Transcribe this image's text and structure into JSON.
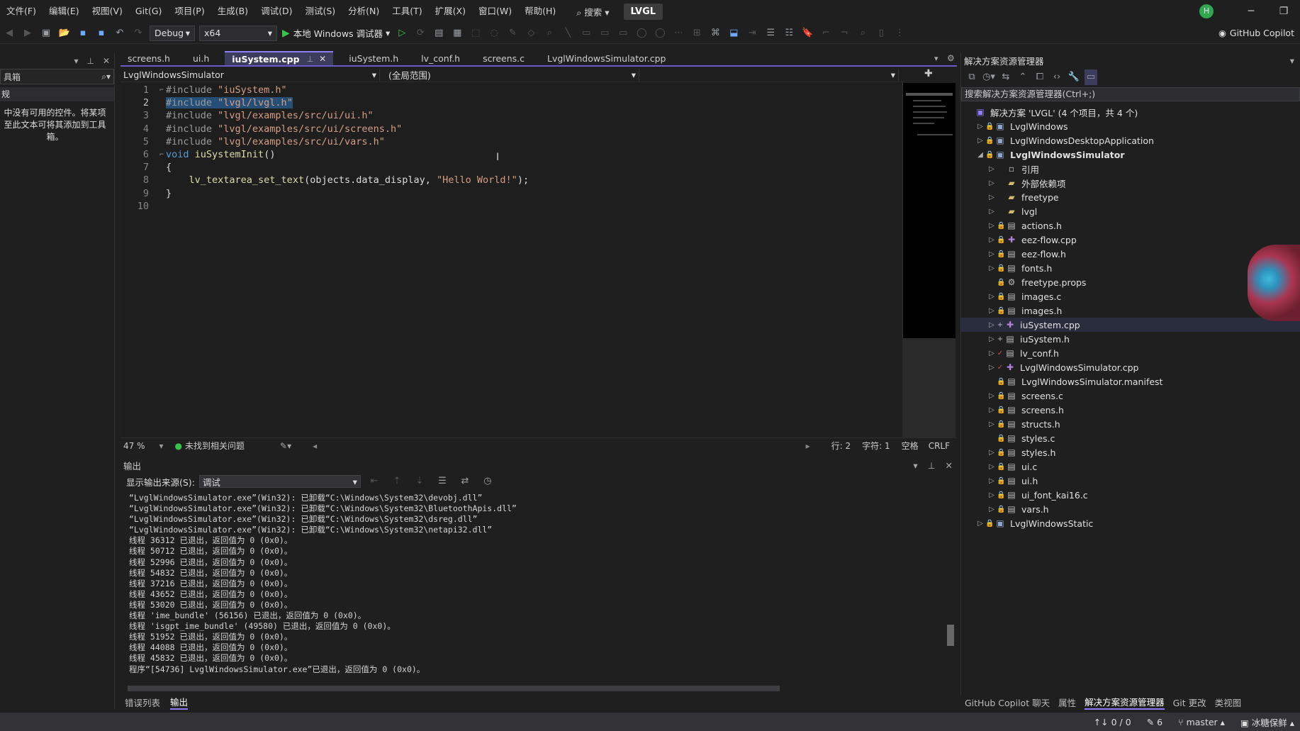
{
  "menu": [
    "文件(F)",
    "编辑(E)",
    "视图(V)",
    "Git(G)",
    "项目(P)",
    "生成(B)",
    "调试(D)",
    "测试(S)",
    "分析(N)",
    "工具(T)",
    "扩展(X)",
    "窗口(W)",
    "帮助(H)"
  ],
  "search_label": "搜索",
  "solution_badge": "LVGL",
  "avatar_initial": "H",
  "toolbar": {
    "config": "Debug",
    "platform": "x64",
    "run_label": "本地 Windows 调试器",
    "copilot_label": "GitHub Copilot"
  },
  "toolbox": {
    "title": "具箱",
    "section": "规",
    "message": "中没有可用的控件。将某项至此文本可将其添加到工具箱。"
  },
  "editor": {
    "tabs": [
      {
        "label": "screens.h",
        "active": false
      },
      {
        "label": "ui.h",
        "active": false
      },
      {
        "label": "iuSystem.cpp",
        "active": true
      },
      {
        "label": "iuSystem.h",
        "active": false
      },
      {
        "label": "lv_conf.h",
        "active": false
      },
      {
        "label": "screens.c",
        "active": false
      },
      {
        "label": "LvglWindowsSimulator.cpp",
        "active": false
      }
    ],
    "nav_project": "LvglWindowsSimulator",
    "nav_scope": "(全局范围)",
    "lines": [
      {
        "n": "1",
        "parts": [
          {
            "t": "#include ",
            "c": "kw-pre"
          },
          {
            "t": "\"iuSystem.h\"",
            "c": "str"
          }
        ]
      },
      {
        "n": "2",
        "parts": [
          {
            "t": "#include ",
            "c": "kw-pre sel"
          },
          {
            "t": "\"lvgl/lvgl.h\"",
            "c": "str sel"
          }
        ]
      },
      {
        "n": "3",
        "parts": [
          {
            "t": "#include ",
            "c": "kw-pre"
          },
          {
            "t": "\"lvgl/examples/src/ui/ui.h\"",
            "c": "str"
          }
        ]
      },
      {
        "n": "4",
        "parts": [
          {
            "t": "#include ",
            "c": "kw-pre"
          },
          {
            "t": "\"lvgl/examples/src/ui/screens.h\"",
            "c": "str"
          }
        ]
      },
      {
        "n": "5",
        "parts": [
          {
            "t": "#include ",
            "c": "kw-pre"
          },
          {
            "t": "\"lvgl/examples/src/ui/vars.h\"",
            "c": "str"
          }
        ]
      },
      {
        "n": "6",
        "parts": [
          {
            "t": "void ",
            "c": "kw"
          },
          {
            "t": "iuSystemInit",
            "c": "fn"
          },
          {
            "t": "()",
            "c": "plain"
          }
        ]
      },
      {
        "n": "7",
        "parts": [
          {
            "t": "{",
            "c": "plain"
          }
        ]
      },
      {
        "n": "8",
        "parts": [
          {
            "t": "    ",
            "c": "plain"
          },
          {
            "t": "lv_textarea_set_text",
            "c": "fn"
          },
          {
            "t": "(objects.data_display, ",
            "c": "plain"
          },
          {
            "t": "\"Hello World!\"",
            "c": "str"
          },
          {
            "t": ");",
            "c": "plain"
          }
        ]
      },
      {
        "n": "9",
        "parts": [
          {
            "t": "}",
            "c": "plain"
          }
        ]
      },
      {
        "n": "10",
        "parts": []
      }
    ],
    "status": {
      "zoom": "47 %",
      "issues": "未找到相关问题",
      "row": "行: 2",
      "col": "字符: 1",
      "whitespace": "空格",
      "eol": "CRLF"
    }
  },
  "output": {
    "title": "输出",
    "source_label": "显示输出来源(S):",
    "source_value": "调试",
    "lines": [
      "“LvglWindowsSimulator.exe”(Win32): 已卸载“C:\\Windows\\System32\\devobj.dll”",
      "“LvglWindowsSimulator.exe”(Win32): 已卸载“C:\\Windows\\System32\\BluetoothApis.dll”",
      "“LvglWindowsSimulator.exe”(Win32): 已卸载“C:\\Windows\\System32\\dsreg.dll”",
      "“LvglWindowsSimulator.exe”(Win32): 已卸载“C:\\Windows\\System32\\netapi32.dll”",
      "线程 36312 已退出，返回值为 0 (0x0)。",
      "线程 50712 已退出，返回值为 0 (0x0)。",
      "线程 52996 已退出，返回值为 0 (0x0)。",
      "线程 54832 已退出，返回值为 0 (0x0)。",
      "线程 37216 已退出，返回值为 0 (0x0)。",
      "线程 43652 已退出，返回值为 0 (0x0)。",
      "线程 53020 已退出，返回值为 0 (0x0)。",
      "线程 'ime_bundle' (56156) 已退出，返回值为 0 (0x0)。",
      "线程 'isgpt_ime_bundle' (49580) 已退出，返回值为 0 (0x0)。",
      "线程 51952 已退出，返回值为 0 (0x0)。",
      "线程 44088 已退出，返回值为 0 (0x0)。",
      "线程 45832 已退出，返回值为 0 (0x0)。",
      "程序“[54736] LvglWindowsSimulator.exe”已退出，返回值为 0 (0x0)。"
    ],
    "tabs": [
      {
        "label": "错误列表",
        "active": false
      },
      {
        "label": "输出",
        "active": true
      }
    ]
  },
  "solution_explorer": {
    "title": "解决方案资源管理器",
    "search_placeholder": "搜索解决方案资源管理器(Ctrl+;)",
    "rows": [
      {
        "label": "解决方案 'LVGL' (4 个项目，共 4 个)",
        "depth": 0,
        "arrow": "",
        "icon": "sol",
        "bold": false
      },
      {
        "label": "LvglWindows",
        "depth": 1,
        "arrow": "▷",
        "icon": "proj",
        "bold": false
      },
      {
        "label": "LvglWindowsDesktopApplication",
        "depth": 1,
        "arrow": "▷",
        "icon": "proj",
        "bold": false
      },
      {
        "label": "LvglWindowsSimulator",
        "depth": 1,
        "arrow": "◢",
        "icon": "proj",
        "bold": true
      },
      {
        "label": "引用",
        "depth": 2,
        "arrow": "▷",
        "icon": "ref",
        "bold": false
      },
      {
        "label": "外部依赖项",
        "depth": 2,
        "arrow": "▷",
        "icon": "folder",
        "bold": false
      },
      {
        "label": "freetype",
        "depth": 2,
        "arrow": "▷",
        "icon": "folder",
        "bold": false
      },
      {
        "label": "lvgl",
        "depth": 2,
        "arrow": "▷",
        "icon": "folder",
        "bold": false
      },
      {
        "label": "actions.h",
        "depth": 2,
        "arrow": "▷",
        "icon": "file",
        "bold": false
      },
      {
        "label": "eez-flow.cpp",
        "depth": 2,
        "arrow": "▷",
        "icon": "cpp",
        "bold": false
      },
      {
        "label": "eez-flow.h",
        "depth": 2,
        "arrow": "▷",
        "icon": "file",
        "bold": false
      },
      {
        "label": "fonts.h",
        "depth": 2,
        "arrow": "▷",
        "icon": "file",
        "bold": false
      },
      {
        "label": "freetype.props",
        "depth": 2,
        "arrow": "",
        "icon": "props",
        "bold": false
      },
      {
        "label": "images.c",
        "depth": 2,
        "arrow": "▷",
        "icon": "file",
        "bold": false
      },
      {
        "label": "images.h",
        "depth": 2,
        "arrow": "▷",
        "icon": "file",
        "bold": false
      },
      {
        "label": "iuSystem.cpp",
        "depth": 2,
        "arrow": "▷",
        "icon": "cpp",
        "bold": false,
        "selected": true
      },
      {
        "label": "iuSystem.h",
        "depth": 2,
        "arrow": "▷",
        "icon": "file",
        "bold": false
      },
      {
        "label": "lv_conf.h",
        "depth": 2,
        "arrow": "▷",
        "icon": "file",
        "bold": false
      },
      {
        "label": "LvglWindowsSimulator.cpp",
        "depth": 2,
        "arrow": "▷",
        "icon": "cpp",
        "bold": false
      },
      {
        "label": "LvglWindowsSimulator.manifest",
        "depth": 2,
        "arrow": "",
        "icon": "file",
        "bold": false
      },
      {
        "label": "screens.c",
        "depth": 2,
        "arrow": "▷",
        "icon": "file",
        "bold": false
      },
      {
        "label": "screens.h",
        "depth": 2,
        "arrow": "▷",
        "icon": "file",
        "bold": false
      },
      {
        "label": "structs.h",
        "depth": 2,
        "arrow": "▷",
        "icon": "file",
        "bold": false
      },
      {
        "label": "styles.c",
        "depth": 2,
        "arrow": "",
        "icon": "file",
        "bold": false
      },
      {
        "label": "styles.h",
        "depth": 2,
        "arrow": "▷",
        "icon": "file",
        "bold": false
      },
      {
        "label": "ui.c",
        "depth": 2,
        "arrow": "▷",
        "icon": "file",
        "bold": false
      },
      {
        "label": "ui.h",
        "depth": 2,
        "arrow": "▷",
        "icon": "file",
        "bold": false
      },
      {
        "label": "ui_font_kai16.c",
        "depth": 2,
        "arrow": "▷",
        "icon": "file",
        "bold": false
      },
      {
        "label": "vars.h",
        "depth": 2,
        "arrow": "▷",
        "icon": "file",
        "bold": false
      },
      {
        "label": "LvglWindowsStatic",
        "depth": 1,
        "arrow": "▷",
        "icon": "proj",
        "bold": false
      }
    ],
    "bottom_tabs": [
      {
        "label": "GitHub Copilot 聊天",
        "active": false
      },
      {
        "label": "属性",
        "active": false
      },
      {
        "label": "解决方案资源管理器",
        "active": true
      },
      {
        "label": "Git 更改",
        "active": false
      },
      {
        "label": "类视图",
        "active": false
      }
    ]
  },
  "statusbar": {
    "sync": "↑↓ 0 / 0",
    "edits": "6",
    "branch": "master",
    "repo": "冰糖保鲜"
  }
}
